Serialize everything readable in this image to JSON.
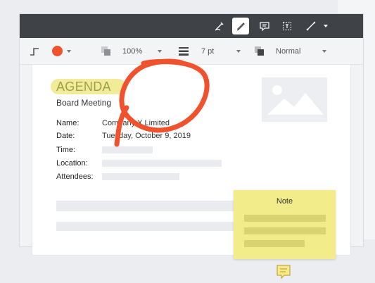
{
  "toolbar": {
    "icons": [
      "freehand-pen-icon",
      "highlighter-pen-icon",
      "comment-icon",
      "text-box-icon",
      "line-icon"
    ]
  },
  "properties": {
    "stroke_color": "#f0522e",
    "opacity": "100%",
    "stroke_width": "7 pt",
    "blend_mode": "Normal"
  },
  "document": {
    "title": "AGENDA",
    "subtitle": "Board Meeting",
    "fields": [
      {
        "label": "Name:",
        "value": "Company X Limited"
      },
      {
        "label": "Date:",
        "value": "Tuesday, October 9, 2019"
      },
      {
        "label": "Time:",
        "value": ""
      },
      {
        "label": "Location:",
        "value": ""
      },
      {
        "label": "Attendees:",
        "value": ""
      }
    ]
  },
  "note": {
    "title": "Note",
    "color": "#f2ec8a"
  },
  "annotation": {
    "circle_color": "#f0522e"
  }
}
